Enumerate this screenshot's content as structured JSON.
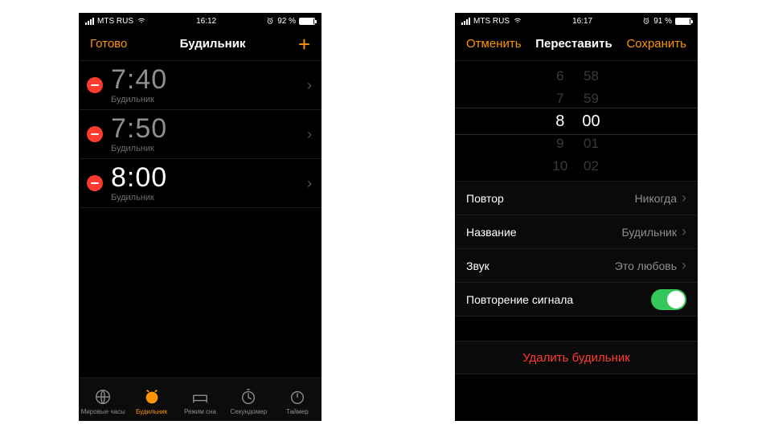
{
  "left": {
    "status": {
      "carrier": "MTS RUS",
      "time": "16:12",
      "battery": "92 %"
    },
    "nav": {
      "left": "Готово",
      "title": "Будильник",
      "add": "+"
    },
    "alarms": [
      {
        "time": "7:40",
        "label": "Будильник",
        "enabled": false
      },
      {
        "time": "7:50",
        "label": "Будильник",
        "enabled": false
      },
      {
        "time": "8:00",
        "label": "Будильник",
        "enabled": true
      }
    ],
    "tabs": [
      {
        "label": "Мировые часы"
      },
      {
        "label": "Будильник"
      },
      {
        "label": "Режим сна"
      },
      {
        "label": "Секундомер"
      },
      {
        "label": "Таймер"
      }
    ]
  },
  "right": {
    "status": {
      "carrier": "MTS RUS",
      "time": "16:17",
      "battery": "91 %"
    },
    "nav": {
      "left": "Отменить",
      "title": "Переставить",
      "right": "Сохранить"
    },
    "picker": {
      "hours": [
        "6",
        "7",
        "8",
        "9",
        "10"
      ],
      "minutes": [
        "58",
        "59",
        "00",
        "01",
        "02"
      ]
    },
    "settings": {
      "repeat_label": "Повтор",
      "repeat_value": "Никогда",
      "name_label": "Название",
      "name_value": "Будильник",
      "sound_label": "Звук",
      "sound_value": "Это любовь",
      "snooze_label": "Повторение сигнала"
    },
    "delete": "Удалить будильник"
  }
}
